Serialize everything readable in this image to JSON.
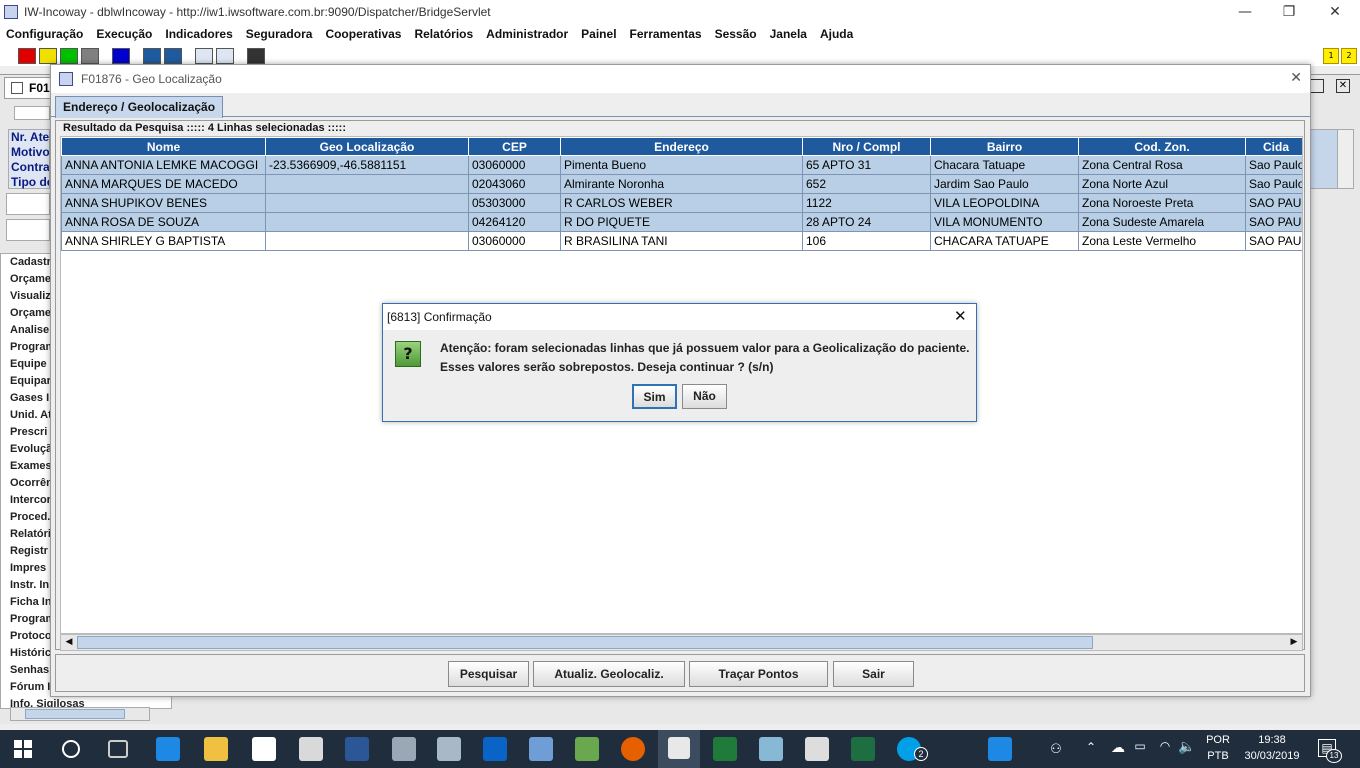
{
  "window": {
    "title": "IW-Incoway - dblwIncoway - http://iw1.iwsoftware.com.br:9090/Dispatcher/BridgeServlet",
    "minimize": "—",
    "maximize": "❐",
    "close": "✕"
  },
  "menu": [
    "Configuração",
    "Execução",
    "Indicadores",
    "Seguradora",
    "Cooperativas",
    "Relatórios",
    "Administrador",
    "Painel",
    "Ferramentas",
    "Sessão",
    "Janela",
    "Ajuda"
  ],
  "toolbar": {
    "badge1": "1",
    "badge2": "2",
    "colors": [
      "#e00000",
      "#f0e000",
      "#00c000",
      "#808080",
      "#0000d0",
      "#1f5a9e",
      "#1f5a9e"
    ]
  },
  "background": {
    "frame_title": "F01",
    "fields": [
      "Nr. Ater",
      "Motivo",
      "Contrat",
      "Tipo de"
    ],
    "list": [
      "Cadastr",
      "Orçame",
      "Visualiz",
      "Orçame",
      "Analise",
      "Program",
      "Equipe",
      "Equipar",
      "Gases I",
      "Unid. At",
      "Prescri",
      "Evolução",
      "Exames",
      "Ocorrên",
      "Intercor",
      "Proced.",
      "Relatóri",
      "Registr",
      "Impres",
      "Instr. In",
      "Ficha In",
      "Program",
      "Protoco",
      "Históric",
      "Senhas",
      "Fórum I",
      "Info. Sigilosas"
    ]
  },
  "dialog": {
    "title": "F01876 - Geo Localização",
    "close": "✕",
    "tab": "Endereço / Geolocalização",
    "group_label": "Resultado da Pesquisa ::::: 4 Linhas selecionadas :::::",
    "columns": [
      "Nome",
      "Geo Localização",
      "CEP",
      "Endereço",
      "Nro / Compl",
      "Bairro",
      "Cod. Zon.",
      "Cida"
    ],
    "rows": [
      {
        "selected": true,
        "cells": [
          "ANNA ANTONIA LEMKE MACOGGI",
          "-23.5366909,-46.5881151",
          "03060000",
          "Pimenta Bueno",
          "65 APTO 31",
          "Chacara Tatuape",
          "Zona Central Rosa",
          "Sao Paulo"
        ]
      },
      {
        "selected": true,
        "cells": [
          "ANNA MARQUES DE MACEDO",
          "",
          "02043060",
          "Almirante Noronha",
          "652",
          "Jardim Sao Paulo",
          "Zona Norte Azul",
          "Sao Paulo"
        ]
      },
      {
        "selected": true,
        "cells": [
          "ANNA SHUPIKOV BENES",
          "",
          "05303000",
          "R CARLOS WEBER",
          "1122",
          "VILA LEOPOLDINA",
          "Zona Noroeste Preta",
          "SAO PAUL"
        ]
      },
      {
        "selected": true,
        "cells": [
          "ANNA ROSA DE SOUZA",
          "",
          "04264120",
          "R DO PIQUETE",
          "28   APTO 24",
          "VILA MONUMENTO",
          "Zona Sudeste Amarela",
          "SAO PAUL"
        ]
      },
      {
        "selected": false,
        "cells": [
          "ANNA SHIRLEY G BAPTISTA",
          "",
          "03060000",
          "R BRASILINA TANI",
          "106",
          "CHACARA TATUAPE",
          "Zona Leste Vermelho",
          "SAO PAUL"
        ]
      }
    ],
    "buttons": {
      "search": "Pesquisar",
      "update": "Atualiz. Geolocaliz.",
      "plot": "Traçar Pontos",
      "exit": "Sair"
    }
  },
  "confirm": {
    "title": "[6813] Confirmação",
    "close": "✕",
    "icon": "?",
    "line1": "Atenção: foram selecionadas linhas que já possuem valor para a Geolicalização do paciente.",
    "line2": "Esses valores serão sobrepostos. Deseja continuar ? (s/n)",
    "yes": "Sim",
    "no": "Não"
  },
  "taskbar": {
    "lang1": "POR",
    "lang2": "PTB",
    "time": "19:38",
    "date": "30/03/2019",
    "skype_badge": "2",
    "notif_count": "13"
  }
}
